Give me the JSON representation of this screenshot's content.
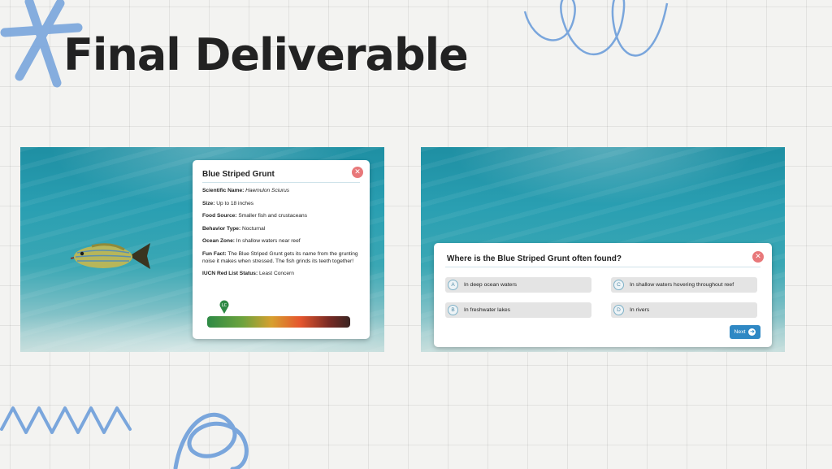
{
  "slide": {
    "title": "Final Deliverable"
  },
  "info_card": {
    "title": "Blue Striped Grunt",
    "close_icon": "close-icon",
    "facts": [
      {
        "label": "Scientific Name:",
        "value": "Haemulon Sciurus"
      },
      {
        "label": "Size:",
        "value": "Up to 18 inches"
      },
      {
        "label": "Food Source:",
        "value": "Smaller fish and crustaceans"
      },
      {
        "label": "Behavior Type:",
        "value": "Nocturnal"
      },
      {
        "label": "Ocean Zone:",
        "value": "In shallow waters near reef"
      },
      {
        "label": "Fun Fact:",
        "value": "The Blue Striped Grunt gets its name from the grunting noise it makes when stressed. The fish grinds its teeth together!"
      },
      {
        "label": "IUCN Red List Status:",
        "value": "Least Concern"
      }
    ],
    "status_marker_label": "LC",
    "status_marker_color": "#2e8a45"
  },
  "quiz_card": {
    "question": "Where is the Blue Striped Grunt often found?",
    "options": [
      {
        "letter": "A",
        "text": "In deep ocean waters"
      },
      {
        "letter": "C",
        "text": "In shallow waters hovering throughout reef"
      },
      {
        "letter": "B",
        "text": "In freshwater lakes"
      },
      {
        "letter": "D",
        "text": "In rivers"
      }
    ],
    "next_label": "Next",
    "next_icon": "arrow-right-icon",
    "accent_color": "#2f88c4"
  },
  "colors": {
    "close": "#e8787a",
    "doodle": "#7aa6dc"
  }
}
